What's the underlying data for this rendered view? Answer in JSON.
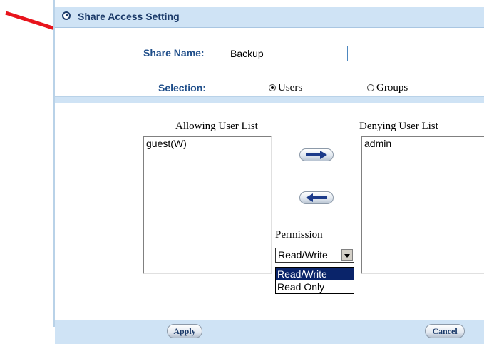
{
  "panel": {
    "title": "Share Access Setting"
  },
  "form": {
    "share_name_label": "Share Name:",
    "share_name_value": "Backup",
    "selection_label": "Selection:",
    "options": [
      {
        "label": "Users",
        "checked": true
      },
      {
        "label": "Groups",
        "checked": false
      }
    ]
  },
  "lists": {
    "allowing": {
      "title": "Allowing User List",
      "items": [
        "guest(W)"
      ]
    },
    "denying": {
      "title": "Denying User List",
      "items": [
        "admin"
      ]
    }
  },
  "permission": {
    "label": "Permission",
    "selected": "Read/Write",
    "options": [
      "Read/Write",
      "Read Only"
    ],
    "highlighted_option": "Read/Write"
  },
  "buttons": {
    "apply": "Apply",
    "cancel": "Cancel",
    "move_right_icon": "arrow-right-icon",
    "move_left_icon": "arrow-left-icon"
  },
  "colors": {
    "accent_blue": "#1c3b6a",
    "panel_bar": "#cfe3f5",
    "annotation_red": "#e8141c"
  }
}
